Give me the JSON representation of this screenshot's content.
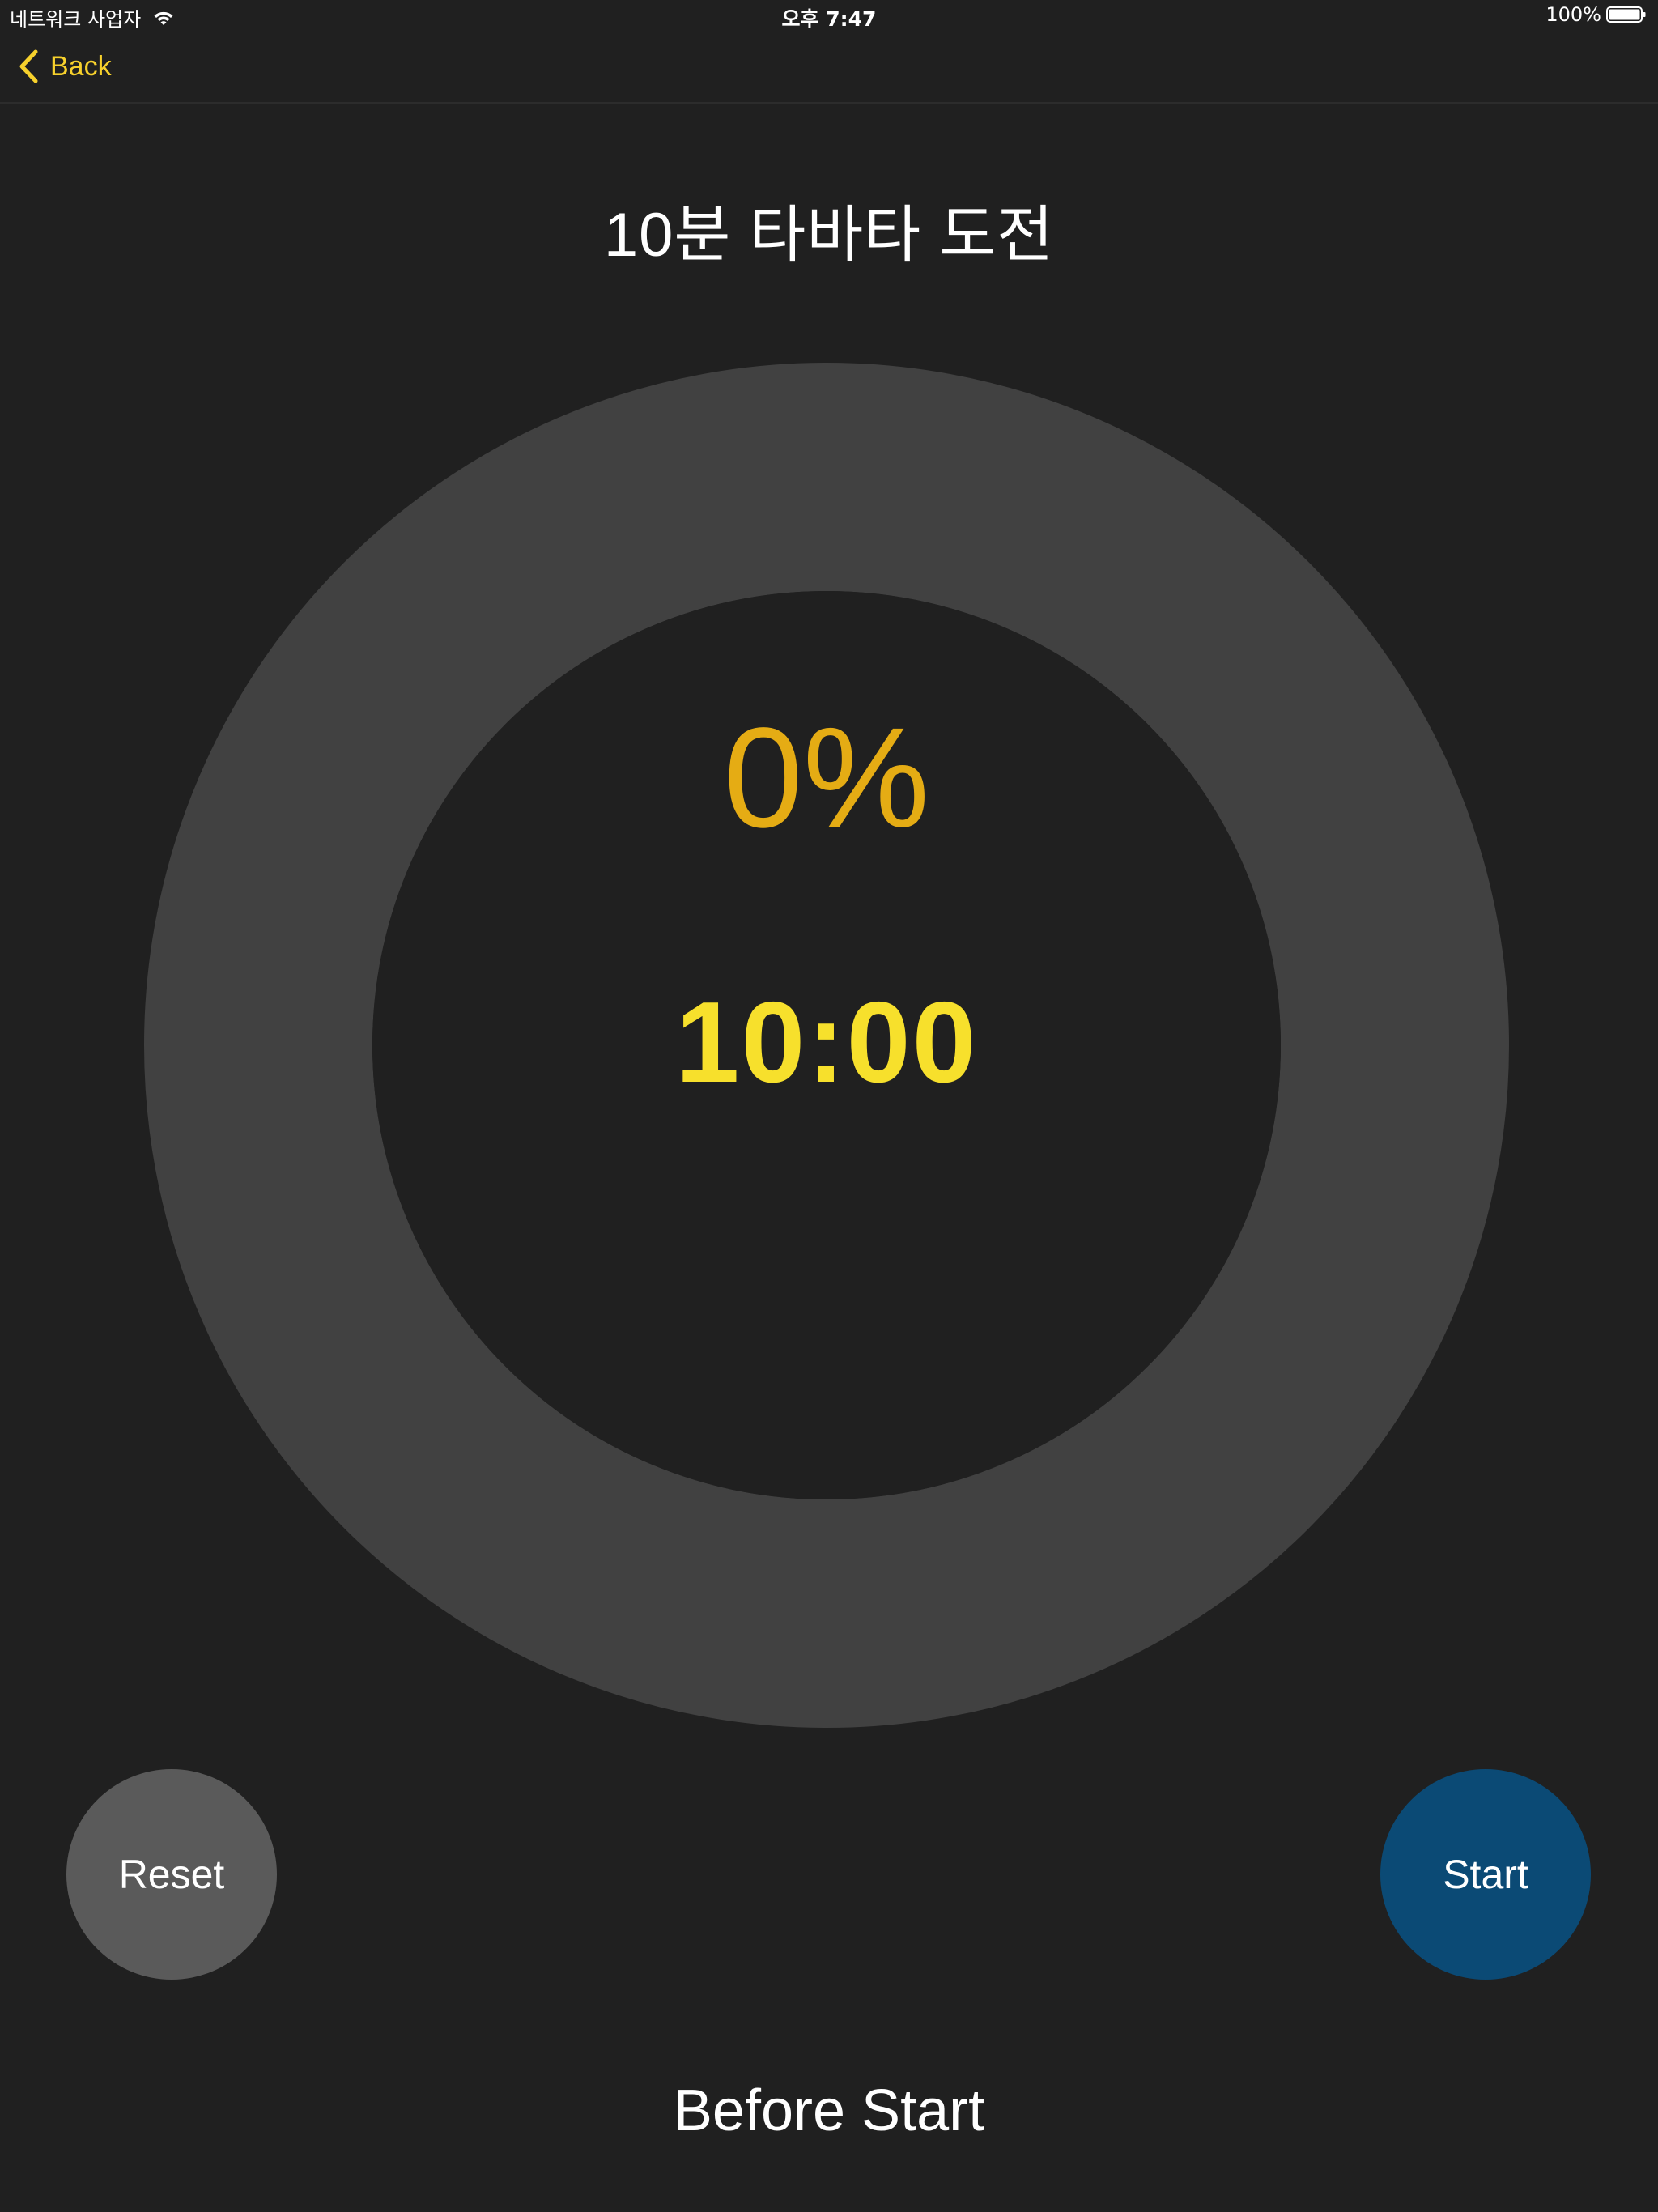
{
  "status_bar": {
    "carrier": "네트워크 사업자",
    "time": "오후 7:47",
    "battery": "100%",
    "battery_level": 1.0,
    "wifi_icon": "wifi-icon",
    "battery_icon": "battery-icon"
  },
  "nav": {
    "back_label": "Back",
    "back_icon": "chevron-left-icon"
  },
  "title": "10분 타바타 도전",
  "timer": {
    "percent": "0%",
    "progress": 0,
    "time": "10:00"
  },
  "buttons": {
    "reset_label": "Reset",
    "start_label": "Start"
  },
  "state_text": "Before Start",
  "colors": {
    "background": "#202020",
    "accent_yellow": "#f7e02c",
    "percent_orange": "#e5ac14",
    "ring_track": "#414141",
    "reset_button": "#5a5a5a",
    "start_button": "#0b4a75"
  }
}
